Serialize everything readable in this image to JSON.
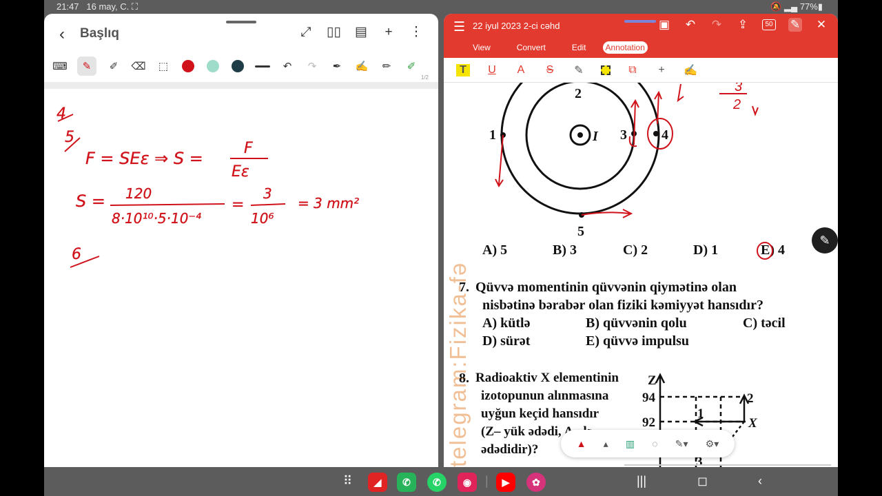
{
  "status": {
    "time": "21:47",
    "date": "16 may, C.",
    "battery": "77%"
  },
  "notes_app": {
    "title": "Başlıq",
    "page_indicator": "1/2",
    "colors": {
      "red": "#d0121a",
      "mint": "#9fdcc9",
      "dark": "#1f3d47"
    },
    "handwriting": {
      "item4": "4",
      "item5": "5",
      "formula1": "F = SEε  ⇒ S =",
      "frac1_num": "F",
      "frac1_den": "Eε",
      "s_eq": "S =",
      "frac2_num": "120",
      "frac2_den": "8·10¹⁰·5·10⁻⁴",
      "eq": "=",
      "frac3_num": "3",
      "frac3_den": "10⁶",
      "result": "= 3 mm²",
      "item6": "6"
    }
  },
  "pdf_app": {
    "doc_title": "22 iyul 2023 2-ci cəhd",
    "zoom_badge": "50",
    "tabs": [
      "View",
      "Convert",
      "Edit",
      "Annotation"
    ],
    "watermark": "telegram:Fizika-fə",
    "diagram_labels": {
      "top": "2",
      "left": "1",
      "center": "I",
      "right_inner": "3",
      "right_outer": "4",
      "bottom": "5"
    },
    "annot_fraction": "3/2",
    "q6_options": [
      "A) 5",
      "B) 3",
      "C) 2",
      "D) 1",
      "E) 4"
    ],
    "q7": {
      "number": "7.",
      "line1": "Qüvvə momentinin qüvvənin qiymətinə olan",
      "line2": "nisbətinə bərabər olan fiziki kəmiyyət hansıdır?",
      "options": [
        "A) kütlə",
        "B) qüvvənin qolu",
        "C) təcil",
        "D) sürət",
        "E) qüvvə impulsu"
      ]
    },
    "q8": {
      "number": "8.",
      "lines": [
        "Radioaktiv X elementinin",
        "izotopunun alınmasına",
        "uyğun keçid hansıdır",
        "(Z– yük ədədi, A– kütlə",
        "ədədidir)?"
      ],
      "axis": "Z",
      "ticks": [
        "94",
        "92"
      ],
      "points": [
        "2",
        "1",
        "X",
        "3"
      ]
    }
  }
}
